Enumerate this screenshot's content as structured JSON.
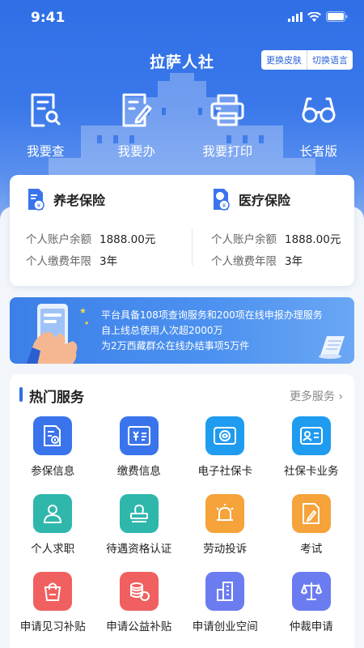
{
  "status_bar": {
    "time": "9:41"
  },
  "header": {
    "title": "拉萨人社",
    "skin_button": "更换皮肤",
    "language_button": "切换语言"
  },
  "quick_actions": [
    {
      "label": "我要查",
      "icon": "document-search-icon"
    },
    {
      "label": "我要办",
      "icon": "document-edit-icon"
    },
    {
      "label": "我要打印",
      "icon": "printer-icon"
    },
    {
      "label": "长者版",
      "icon": "glasses-icon"
    }
  ],
  "insurance": {
    "pension": {
      "title": "养老保险",
      "balance_label": "个人账户余额",
      "balance_value": "1888.00元",
      "years_label": "个人缴费年限",
      "years_value": "3年"
    },
    "medical": {
      "title": "医疗保险",
      "balance_label": "个人账户余额",
      "balance_value": "1888.00元",
      "years_label": "个人缴费年限",
      "years_value": "3年"
    }
  },
  "banner": {
    "line1": "平台具备108项查询服务和200项在线申报办理服务",
    "line2": "自上线总使用人次超2000万",
    "line3": "为2万西藏群众在线办结事项5万件"
  },
  "services": {
    "title": "热门服务",
    "more": "更多服务 ›",
    "items": [
      {
        "label": "参保信息",
        "icon": "insurance-info-icon",
        "color": "#3a74ec"
      },
      {
        "label": "缴费信息",
        "icon": "payment-info-icon",
        "color": "#3a74ec"
      },
      {
        "label": "电子社保卡",
        "icon": "e-card-icon",
        "color": "#1f9cf0"
      },
      {
        "label": "社保卡业务",
        "icon": "id-card-icon",
        "color": "#1f9cf0"
      },
      {
        "label": "个人求职",
        "icon": "job-seeker-icon",
        "color": "#2fb7ac"
      },
      {
        "label": "待遇资格认证",
        "icon": "stamp-icon",
        "color": "#2fb7ac"
      },
      {
        "label": "劳动投诉",
        "icon": "alarm-icon",
        "color": "#f5a33a"
      },
      {
        "label": "考试",
        "icon": "exam-icon",
        "color": "#f5a33a"
      },
      {
        "label": "申请见习补贴",
        "icon": "bag-icon",
        "color": "#f06060"
      },
      {
        "label": "申请公益补贴",
        "icon": "coins-icon",
        "color": "#f06060"
      },
      {
        "label": "申请创业空间",
        "icon": "building-icon",
        "color": "#6b7cf0"
      },
      {
        "label": "仲裁申请",
        "icon": "scale-icon",
        "color": "#6b7cf0"
      }
    ]
  }
}
